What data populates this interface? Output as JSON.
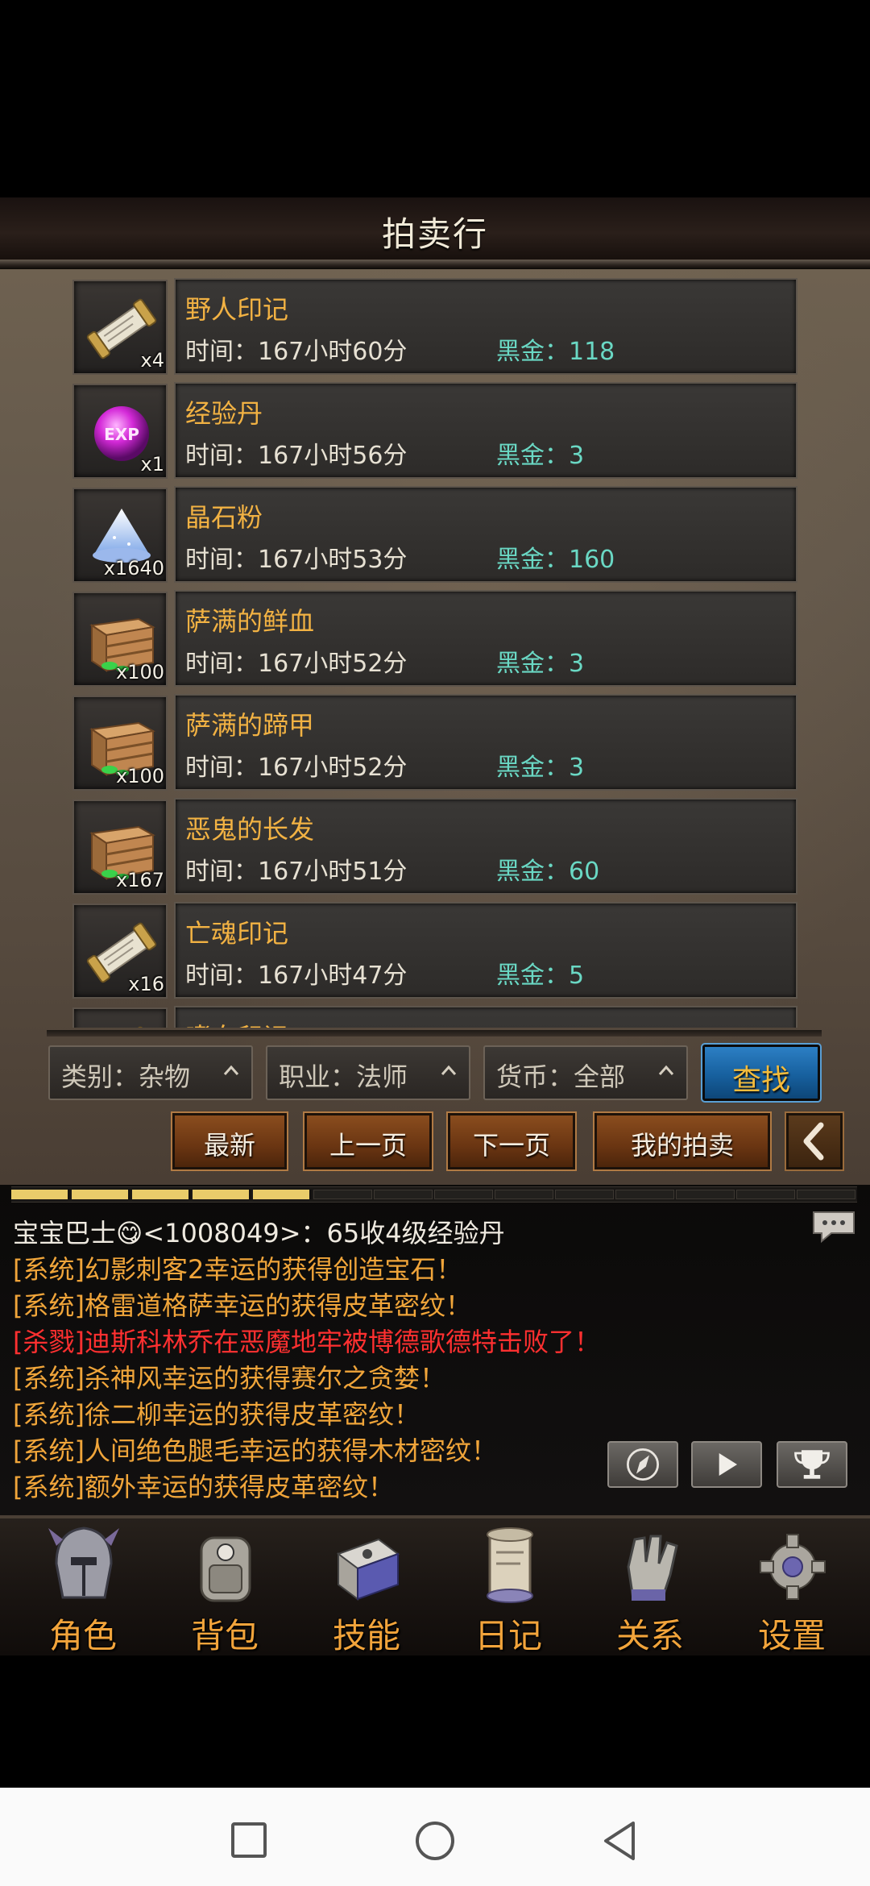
{
  "header": {
    "title": "拍卖行"
  },
  "listings": [
    {
      "name": "野人印记",
      "qty": "x4",
      "time": "时间：167小时60分",
      "price": "黑金：118",
      "icon": "scroll-icon"
    },
    {
      "name": "经验丹",
      "qty": "x1",
      "time": "时间：167小时56分",
      "price": "黑金：3",
      "icon": "exp-orb-icon"
    },
    {
      "name": "晶石粉",
      "qty": "x1640",
      "time": "时间：167小时53分",
      "price": "黑金：160",
      "icon": "crystal-powder-icon"
    },
    {
      "name": "萨满的鲜血",
      "qty": "x100",
      "time": "时间：167小时52分",
      "price": "黑金：3",
      "icon": "crate-icon"
    },
    {
      "name": "萨满的蹄甲",
      "qty": "x100",
      "time": "时间：167小时52分",
      "price": "黑金：3",
      "icon": "crate-icon"
    },
    {
      "name": "恶鬼的长发",
      "qty": "x167",
      "time": "时间：167小时51分",
      "price": "黑金：60",
      "icon": "crate-icon"
    },
    {
      "name": "亡魂印记",
      "qty": "x16",
      "time": "时间：167小时47分",
      "price": "黑金：5",
      "icon": "scroll-icon"
    },
    {
      "name": "嗜血印记",
      "qty": "",
      "time": "",
      "price": "",
      "icon": "scroll-icon"
    }
  ],
  "filters": {
    "category": "类别：杂物",
    "profession": "职业：法师",
    "currency": "货币：全部",
    "search": "查找"
  },
  "paging": {
    "newest": "最新",
    "prev": "上一页",
    "next": "下一页",
    "mine": "我的拍卖"
  },
  "chat": {
    "exp_progress_segments_filled": 5,
    "exp_progress_segments_total": 14,
    "lines": [
      {
        "text": "宝宝巴士😋<1008049>：65收4级经验丹",
        "color": "#efeae0"
      },
      {
        "text": "[系统]幻影刺客2幸运的获得创造宝石！",
        "color": "#f0a53a"
      },
      {
        "text": "[系统]格雷道格萨幸运的获得皮革密纹！",
        "color": "#f0a53a"
      },
      {
        "text": "[杀戮]迪斯科林乔在恶魔地牢被博德歌德特击败了！",
        "color": "#ff3030"
      },
      {
        "text": "[系统]杀神风幸运的获得赛尔之贪婪！",
        "color": "#f0a53a"
      },
      {
        "text": "[系统]徐二柳幸运的获得皮革密纹！",
        "color": "#f0a53a"
      },
      {
        "text": "[系统]人间绝色腿毛幸运的获得木材密纹！",
        "color": "#f0a53a"
      },
      {
        "text": "[系统]额外幸运的获得皮革密纹！",
        "color": "#f0a53a"
      }
    ]
  },
  "tabs": [
    {
      "label": "角色",
      "icon": "helmet-icon"
    },
    {
      "label": "背包",
      "icon": "backpack-icon"
    },
    {
      "label": "技能",
      "icon": "skill-book-icon"
    },
    {
      "label": "日记",
      "icon": "journal-scroll-icon"
    },
    {
      "label": "关系",
      "icon": "gauntlet-icon"
    },
    {
      "label": "设置",
      "icon": "gear-icon"
    }
  ]
}
